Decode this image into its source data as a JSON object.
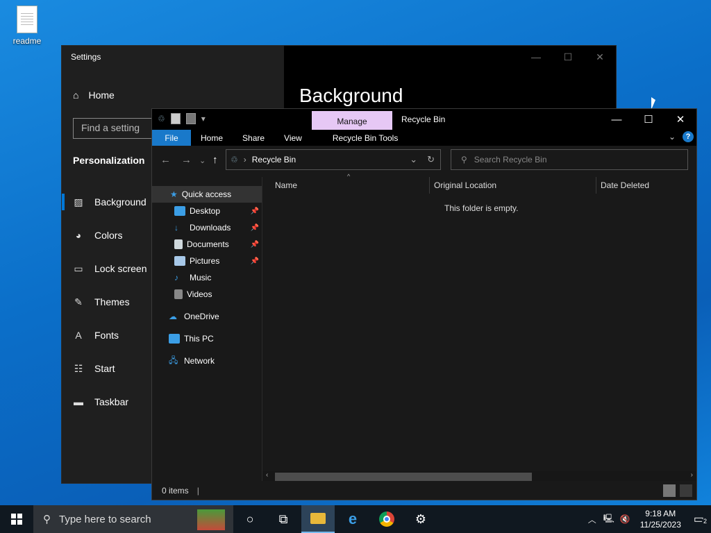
{
  "desktop": {
    "icon_label": "readme"
  },
  "settings": {
    "title": "Settings",
    "home": "Home",
    "search_placeholder": "Find a setting",
    "section": "Personalization",
    "nav": [
      {
        "label": "Background",
        "icon": "image-icon"
      },
      {
        "label": "Colors",
        "icon": "palette-icon"
      },
      {
        "label": "Lock screen",
        "icon": "lock-screen-icon"
      },
      {
        "label": "Themes",
        "icon": "themes-icon"
      },
      {
        "label": "Fonts",
        "icon": "fonts-icon"
      },
      {
        "label": "Start",
        "icon": "start-icon"
      },
      {
        "label": "Taskbar",
        "icon": "taskbar-icon"
      }
    ],
    "page_title": "Background"
  },
  "explorer": {
    "context_tab": "Manage",
    "title": "Recycle Bin",
    "ribbon_tabs": [
      "File",
      "Home",
      "Share",
      "View",
      "Recycle Bin Tools"
    ],
    "address": "Recycle Bin",
    "search_placeholder": "Search Recycle Bin",
    "columns": [
      "Name",
      "Original Location",
      "Date Deleted"
    ],
    "empty_message": "This folder is empty.",
    "status": "0 items",
    "nav_tree": [
      {
        "label": "Quick access",
        "color": "#3b9ee6"
      },
      {
        "label": "Desktop",
        "color": "#3b9ee6"
      },
      {
        "label": "Downloads",
        "color": "#3b9ee6"
      },
      {
        "label": "Documents",
        "color": "#cfd8dc"
      },
      {
        "label": "Pictures",
        "color": "#a7c8e8"
      },
      {
        "label": "Music",
        "color": "#3b9ee6"
      },
      {
        "label": "Videos",
        "color": "#888"
      },
      {
        "label": "OneDrive",
        "color": "#3b9ee6"
      },
      {
        "label": "This PC",
        "color": "#3b9ee6"
      },
      {
        "label": "Network",
        "color": "#3b9ee6"
      }
    ]
  },
  "taskbar": {
    "search_placeholder": "Type here to search",
    "time": "9:18 AM",
    "date": "11/25/2023",
    "notification_count": "2"
  }
}
